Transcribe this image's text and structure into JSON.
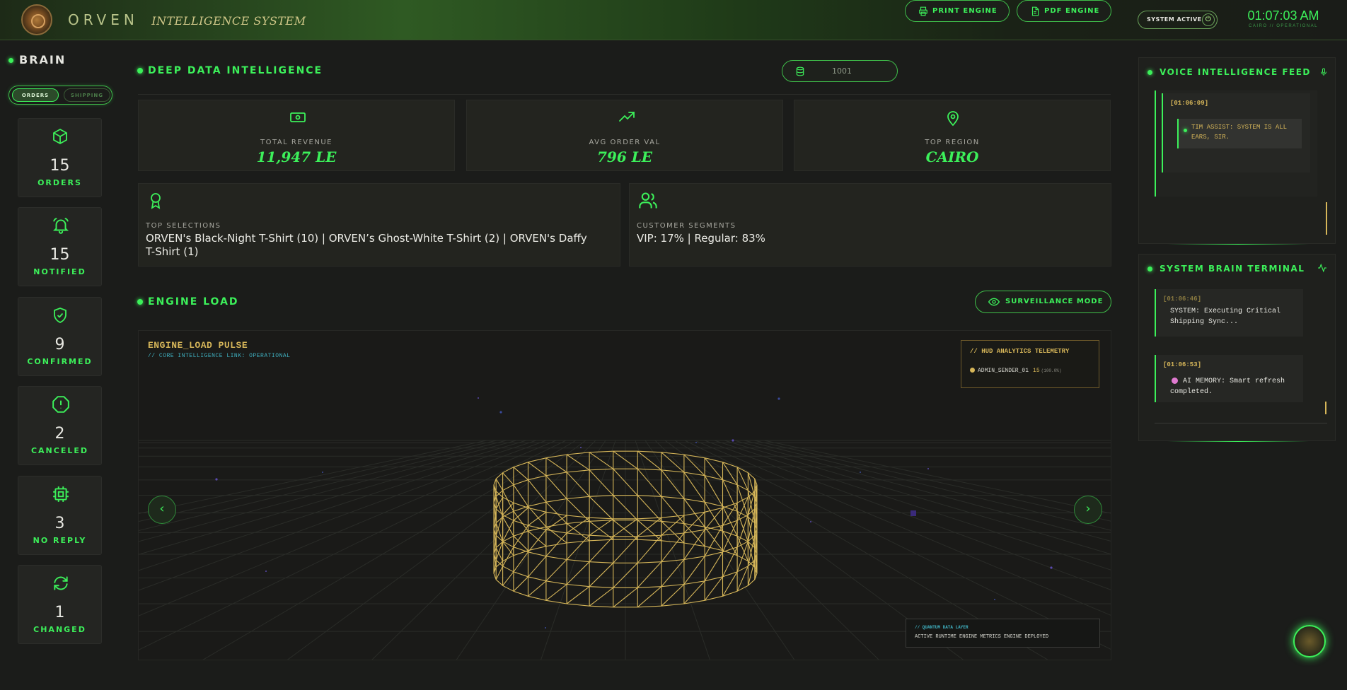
{
  "header": {
    "brand": "ORVEN",
    "brand_sub": "INTELLIGENCE SYSTEM",
    "status_label": "SYSTEM ACTIVE",
    "clock_time": "01:07:03 AM",
    "clock_sub": "CAIRO // OPERATIONAL"
  },
  "sidebar": {
    "title": "BRAIN",
    "toggle": {
      "active": "ORDERS",
      "inactive": "SHIPPING"
    },
    "stats": [
      {
        "value": "15",
        "label": "ORDERS",
        "icon": "cube-icon"
      },
      {
        "value": "15",
        "label": "NOTIFIED",
        "icon": "bell-icon"
      },
      {
        "value": "9",
        "label": "CONFIRMED",
        "icon": "shield-check-icon"
      },
      {
        "value": "2",
        "label": "CANCELED",
        "icon": "alert-octagon-icon"
      },
      {
        "value": "3",
        "label": "NO REPLY",
        "icon": "chip-icon"
      },
      {
        "value": "1",
        "label": "CHANGED",
        "icon": "refresh-icon"
      }
    ]
  },
  "main": {
    "section_title": "DEEP DATA INTELLIGENCE",
    "order_input_value": "1001",
    "print_label": "PRINT ENGINE",
    "pdf_label": "PDF ENGINE",
    "kpis": [
      {
        "label": "TOTAL REVENUE",
        "value": "11,947 LE",
        "icon": "banknote-icon"
      },
      {
        "label": "AVG ORDER VAL",
        "value": "796 LE",
        "icon": "trending-up-icon"
      },
      {
        "label": "TOP REGION",
        "value": "CAIRO",
        "icon": "map-pin-icon"
      }
    ],
    "top_selections": {
      "label": "TOP SELECTIONS",
      "value": "ORVEN's Black-Night T-Shirt (10) | ORVEN’s Ghost-White T-Shirt (2) | ORVEN's Daffy T-Shirt (1)"
    },
    "customer_segments": {
      "label": "CUSTOMER SEGMENTS",
      "value": "VIP: 17% | Regular: 83%"
    },
    "engine_title": "ENGINE LOAD",
    "surveillance_label": "SURVEILLANCE MODE",
    "viewport": {
      "title": "ENGINE_LOAD PULSE",
      "subtitle": "// CORE INTELLIGENCE LINK: OPERATIONAL",
      "hud_title": "// HUD ANALYTICS TELEMETRY",
      "hud_sender": "ADMIN_SENDER_01",
      "hud_count": "15",
      "hud_pct": "(100.0%)",
      "qdl_title": "// QUANTUM DATA LAYER",
      "qdl_text": "ACTIVE RUNTIME ENGINE METRICS ENGINE DEPLOYED",
      "prev": "‹",
      "next": "›"
    }
  },
  "voice_feed": {
    "title": "VOICE INTELLIGENCE FEED",
    "entries": [
      {
        "time": "[01:06:09]",
        "text": "TIM ASSIST: SYSTEM IS ALL EARS, SIR."
      }
    ]
  },
  "terminal": {
    "title": "SYSTEM BRAIN TERMINAL",
    "entries": [
      {
        "time": "[01:06:46]",
        "text": "SYSTEM: Executing Critical Shipping Sync..."
      },
      {
        "time": "[01:06:53]",
        "text": "AI MEMORY: Smart refresh completed."
      }
    ]
  },
  "colors": {
    "accent": "#3cf05a",
    "gold": "#d6b659",
    "cyan": "#3fb0c0",
    "panel": "#23241f",
    "background": "#1b1c1a"
  }
}
